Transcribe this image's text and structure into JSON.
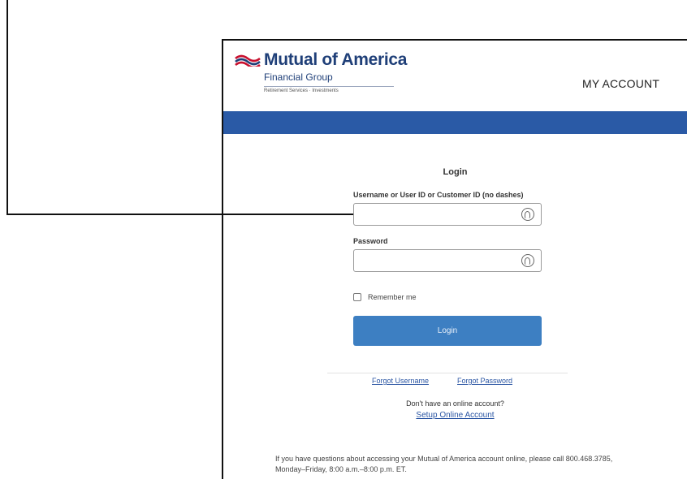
{
  "brand": {
    "name": "Mutual of America",
    "subtitle": "Financial Group",
    "tagline": "Retirement Services · Investments",
    "primary_color": "#1f3f78",
    "band_color": "#2a5aa6"
  },
  "header": {
    "account_label": "MY ACCOUNT"
  },
  "login_form": {
    "title": "Login",
    "username_label": "Username or User ID or Customer ID (no dashes)",
    "username_value": "",
    "password_label": "Password",
    "password_value": "",
    "remember_label": "Remember me",
    "remember_checked": false,
    "submit_label": "Login",
    "submit_color": "#3d7fc2"
  },
  "links": {
    "forgot_username": "Forgot Username",
    "forgot_password": "Forgot Password",
    "no_account": "Don't have an online account?",
    "setup": "Setup Online Account"
  },
  "help_text": "If you have questions about accessing your Mutual of America account online, please call 800.468.3785, Monday–Friday, 8:00 a.m.–8:00 p.m. ET.",
  "icons": {
    "field_icon": "password-reveal-icon",
    "logo_icon": "flag-logo-icon"
  }
}
